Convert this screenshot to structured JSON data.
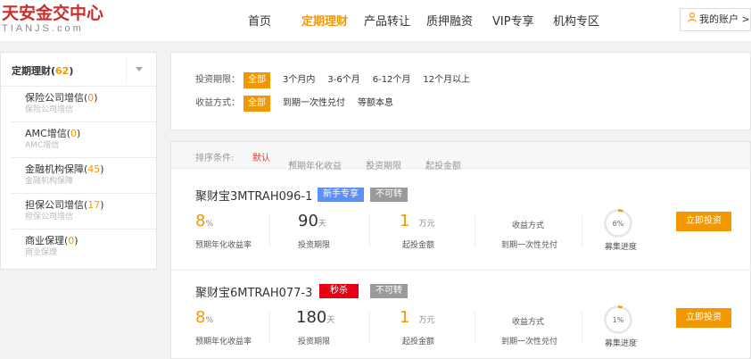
{
  "header": {
    "logo_cn": "天安金交中心",
    "logo_en": "TIANJS.com",
    "nav": [
      "首页",
      "定期理财",
      "产品转让",
      "质押融资",
      "VIP专享",
      "机构专区"
    ],
    "active_nav": "定期理财",
    "account_label": "我的账户 >"
  },
  "sidebar": {
    "title": "定期理财",
    "count": "62",
    "items": [
      {
        "label": "保险公司增信",
        "count": "0",
        "sub": "保险公司增信"
      },
      {
        "label": "AMC增信",
        "count": "0",
        "sub": "AMC增信"
      },
      {
        "label": "金融机构保障",
        "count": "45",
        "sub": "金融机构保障"
      },
      {
        "label": "担保公司增信",
        "count": "17",
        "sub": "担保公司增信"
      },
      {
        "label": "商业保理",
        "count": "0",
        "sub": "商业保理"
      }
    ]
  },
  "filters": {
    "term_label": "投资期限：",
    "term_options": [
      "全部",
      "3个月内",
      "3-6个月",
      "6-12个月",
      "12个月以上"
    ],
    "return_label": "收益方式：",
    "return_options": [
      "全部",
      "到期一次性兑付",
      "等额本息"
    ]
  },
  "sortbar": {
    "label": "排序条件:",
    "default": "默认",
    "opt1": "预期年化收益",
    "opt2": "投资期限",
    "opt3": "起投金额",
    "arrow": "⇣"
  },
  "products": [
    {
      "name": "聚财宝3MTRAH096-1",
      "tag1": "新手专享",
      "tag2": "不可转",
      "rate": "8",
      "rate_unit": "%",
      "rate_label": "预期年化收益率",
      "term": "90",
      "term_unit": "天",
      "term_label": "投资期限",
      "min": "1",
      "min_unit": "万元",
      "min_label": "起投金额",
      "return_value": "收益方式",
      "return_label": "到期一次性兑付",
      "progress_text": "6%",
      "progress": 0.06,
      "progress_label": "募集进度",
      "button": "立即投资"
    },
    {
      "name": "聚财宝6MTRAH077-3",
      "tag1": "秒杀",
      "tag2": "不可转",
      "rate": "8",
      "rate_unit": "%",
      "rate_label": "预期年化收益率",
      "term": "180",
      "term_unit": "天",
      "term_label": "投资期限",
      "min": "1",
      "min_unit": "万元",
      "min_label": "起投金额",
      "return_value": "收益方式",
      "return_label": "到期一次性兑付",
      "progress_text": "1%",
      "progress": 0.01,
      "progress_label": "募集进度",
      "button": "立即投资"
    }
  ],
  "colors": {
    "accent": "#f39800",
    "red": "#e60012",
    "blue_tag": "#5b8ff9",
    "gray_tag": "#9a9a9a"
  }
}
